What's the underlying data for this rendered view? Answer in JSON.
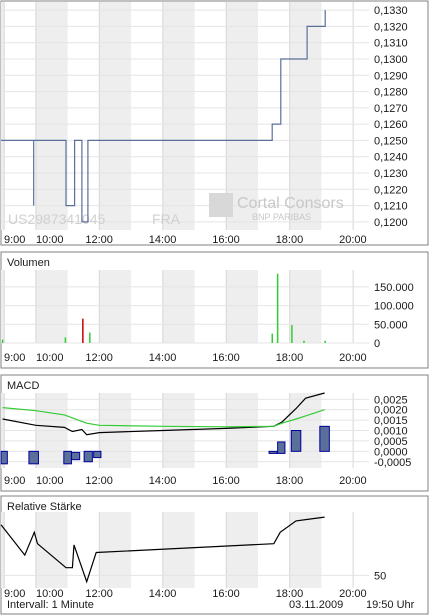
{
  "footer": {
    "interval": "Intervall: 1 Minute",
    "date": "03.11.2009",
    "time": "19:50 Uhr"
  },
  "watermark": {
    "brand": "Cortal Consors",
    "sub": "BNP PARIBAS",
    "isin": "US2987341045",
    "exchange": "FRA"
  },
  "colors": {
    "price_line": "#5a6f99",
    "volume_up": "#33cc33",
    "volume_down": "#cc0000",
    "macd_line": "#000000",
    "signal_line": "#33cc33",
    "histogram_fill": "#5a6f99",
    "histogram_border": "#00009a",
    "rsi_line": "#000000",
    "band_shade": "#eeeeee"
  },
  "chart_data": [
    {
      "id": "price",
      "type": "line",
      "title": "",
      "x_ticks": [
        "9:00",
        "10:00",
        "12:00",
        "14:00",
        "16:00",
        "18:00",
        "20:00"
      ],
      "x_range": [
        8.9,
        20.5
      ],
      "ylim": [
        0.1195,
        0.1335
      ],
      "y_ticks": [
        "0,1200",
        "0,1210",
        "0,1220",
        "0,1230",
        "0,1240",
        "0,1250",
        "0,1260",
        "0,1270",
        "0,1280",
        "0,1290",
        "0,1300",
        "0,1310",
        "0,1320",
        "0,1330"
      ],
      "y_tick_values": [
        0.12,
        0.121,
        0.122,
        0.123,
        0.124,
        0.125,
        0.126,
        0.127,
        0.128,
        0.129,
        0.13,
        0.131,
        0.132,
        0.133
      ],
      "grid": true,
      "series": [
        {
          "x": [
            8.9,
            9.93,
            9.93,
            9.93,
            9.93,
            10.95,
            10.95,
            11.22,
            11.22,
            11.45,
            11.45,
            11.64,
            11.64,
            11.83,
            11.83,
            17.45,
            17.45,
            17.72,
            17.72,
            18.55,
            18.55,
            19.12,
            19.12
          ],
          "y": [
            0.125,
            0.125,
            0.121,
            0.121,
            0.125,
            0.125,
            0.121,
            0.121,
            0.125,
            0.125,
            0.12,
            0.12,
            0.125,
            0.125,
            0.125,
            0.125,
            0.126,
            0.126,
            0.13,
            0.13,
            0.132,
            0.132,
            0.133
          ]
        }
      ]
    },
    {
      "id": "volume",
      "type": "bar",
      "title": "Volumen",
      "x_ticks": [
        "9:00",
        "10:00",
        "12:00",
        "14:00",
        "16:00",
        "18:00",
        "20:00"
      ],
      "x_range": [
        8.9,
        20.5
      ],
      "ylim": [
        0,
        195000
      ],
      "y_ticks": [
        "0",
        "50.000",
        "100.000",
        "150.000"
      ],
      "y_tick_values": [
        0,
        50000,
        100000,
        150000
      ],
      "grid": true,
      "series": [
        {
          "name": "up",
          "x": [
            8.95,
            10.93,
            11.7,
            17.45,
            17.62,
            18.07,
            18.45,
            19.12
          ],
          "values": [
            9000,
            15000,
            28000,
            25000,
            185000,
            48000,
            6000,
            6000
          ]
        },
        {
          "name": "down",
          "x": [
            11.48
          ],
          "values": [
            65000
          ]
        }
      ]
    },
    {
      "id": "macd",
      "type": "line",
      "title": "MACD",
      "x_ticks": [
        "9:00",
        "10:00",
        "12:00",
        "14:00",
        "16:00",
        "18:00",
        "20:00"
      ],
      "x_range": [
        8.9,
        20.5
      ],
      "ylim": [
        -0.0008,
        0.0028
      ],
      "y_ticks": [
        "-0,0005",
        "0,0000",
        "0,0005",
        "0,0010",
        "0,0015",
        "0,0020",
        "0,0025"
      ],
      "y_tick_values": [
        -0.0005,
        0,
        0.0005,
        0.001,
        0.0015,
        0.002,
        0.0025
      ],
      "grid": true,
      "series": [
        {
          "name": "macd",
          "x": [
            8.95,
            10.0,
            10.9,
            11.15,
            11.45,
            11.6,
            12.0,
            14.0,
            16.0,
            17.5,
            17.75,
            18.2,
            18.5,
            19.1
          ],
          "y": [
            0.00155,
            0.00125,
            0.00115,
            0.00095,
            0.00105,
            0.0008,
            0.0009,
            0.001,
            0.0011,
            0.0012,
            0.0014,
            0.00205,
            0.00255,
            0.0028
          ]
        },
        {
          "name": "signal",
          "x": [
            8.95,
            10.0,
            10.9,
            11.6,
            12.0,
            14.0,
            16.0,
            17.5,
            17.75,
            18.2,
            18.5,
            19.1
          ],
          "y": [
            0.0021,
            0.00195,
            0.00175,
            0.00135,
            0.00125,
            0.0012,
            0.00118,
            0.0012,
            0.00135,
            0.00155,
            0.0017,
            0.002
          ]
        }
      ],
      "histogram": {
        "bars": [
          {
            "x0": 8.9,
            "x1": 9.1,
            "top": 0.0,
            "bottom": -0.0006
          },
          {
            "x0": 9.78,
            "x1": 10.08,
            "top": 0.0,
            "bottom": -0.0006
          },
          {
            "x0": 10.88,
            "x1": 11.12,
            "top": 0.0,
            "bottom": -0.0006
          },
          {
            "x0": 11.12,
            "x1": 11.38,
            "top": -5e-05,
            "bottom": -0.0004
          },
          {
            "x0": 11.52,
            "x1": 11.78,
            "top": 0.0,
            "bottom": -0.0005
          },
          {
            "x0": 11.82,
            "x1": 12.05,
            "top": 0.0,
            "bottom": -0.0003
          },
          {
            "x0": 17.35,
            "x1": 17.6,
            "top": 0.0,
            "bottom": -0.0001
          },
          {
            "x0": 17.62,
            "x1": 17.85,
            "top": 0.00045,
            "bottom": -0.0001
          },
          {
            "x0": 18.05,
            "x1": 18.35,
            "top": 0.001,
            "bottom": 0.0
          },
          {
            "x0": 18.95,
            "x1": 19.25,
            "top": 0.0012,
            "bottom": 0.0
          }
        ]
      }
    },
    {
      "id": "rsi",
      "type": "line",
      "title": "Relative Stärke",
      "x_ticks": [
        "9:00",
        "10:00",
        "12:00",
        "14:00",
        "16:00",
        "18:00",
        "20:00"
      ],
      "x_range": [
        8.9,
        20.5
      ],
      "ylim": [
        40,
        100
      ],
      "y_ticks": [
        "50"
      ],
      "y_tick_values": [
        50
      ],
      "grid": true,
      "series": [
        {
          "x": [
            8.9,
            9.65,
            9.95,
            10.05,
            10.95,
            11.15,
            11.2,
            11.6,
            11.9,
            17.5,
            17.7,
            18.2,
            18.5,
            19.1
          ],
          "y": [
            90,
            66,
            84,
            75,
            56,
            56,
            74,
            45,
            68,
            75,
            84,
            93,
            94,
            96
          ]
        }
      ]
    }
  ]
}
